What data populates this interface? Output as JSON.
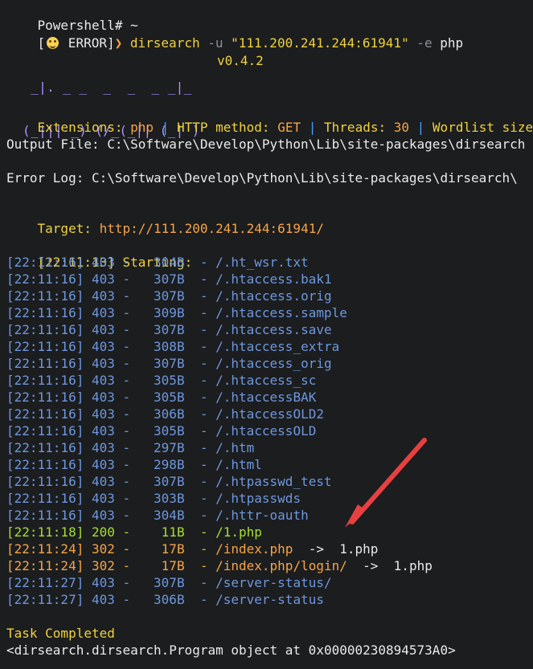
{
  "app": {
    "title": "Powershell# ~"
  },
  "prompt": {
    "prefix": "[",
    "emoji_icon": "grinning-face-icon",
    "status": " ERROR",
    "suffix": "]",
    "chevron": "❯",
    "command": "dirsearch",
    "args": [
      {
        "text": "-u",
        "kind": "flag"
      },
      {
        "text": "\"111.200.241.244:61941\"",
        "kind": "string"
      },
      {
        "text": "-e",
        "kind": "flag"
      },
      {
        "text": "php",
        "kind": "value"
      }
    ]
  },
  "logo": {
    "lines": [
      "  _|. _ _  _  _  _ _|_",
      " (_||| _) (/_(_|| (_| )"
    ],
    "version": "v0.4.2"
  },
  "summary": {
    "extensions_label": "Extensions:",
    "extensions_value": "php",
    "sep1": "|",
    "method_label": "HTTP method:",
    "method_value": "GET",
    "sep2": "|",
    "threads_label": "Threads:",
    "threads_value": "30",
    "sep3": "|",
    "wordlist_label": "Wordlist size:"
  },
  "output_file": "Output File: C:\\Software\\Develop\\Python\\Lib\\site-packages\\dirsearch",
  "error_log": "Error Log: C:\\Software\\Develop\\Python\\Lib\\site-packages\\dirsearch\\",
  "target": {
    "label": "Target:",
    "url": "http://111.200.241.244:61941/"
  },
  "starting": {
    "time": "[22:11:13]",
    "text": "Starting:"
  },
  "results": [
    {
      "time": "[22:11:16]",
      "code": "403",
      "size": "304B",
      "path": "/.ht_wsr.txt"
    },
    {
      "time": "[22:11:16]",
      "code": "403",
      "size": "307B",
      "path": "/.htaccess.bak1"
    },
    {
      "time": "[22:11:16]",
      "code": "403",
      "size": "307B",
      "path": "/.htaccess.orig"
    },
    {
      "time": "[22:11:16]",
      "code": "403",
      "size": "309B",
      "path": "/.htaccess.sample"
    },
    {
      "time": "[22:11:16]",
      "code": "403",
      "size": "307B",
      "path": "/.htaccess.save"
    },
    {
      "time": "[22:11:16]",
      "code": "403",
      "size": "308B",
      "path": "/.htaccess_extra"
    },
    {
      "time": "[22:11:16]",
      "code": "403",
      "size": "307B",
      "path": "/.htaccess_orig"
    },
    {
      "time": "[22:11:16]",
      "code": "403",
      "size": "305B",
      "path": "/.htaccess_sc"
    },
    {
      "time": "[22:11:16]",
      "code": "403",
      "size": "305B",
      "path": "/.htaccessBAK"
    },
    {
      "time": "[22:11:16]",
      "code": "403",
      "size": "306B",
      "path": "/.htaccessOLD2"
    },
    {
      "time": "[22:11:16]",
      "code": "403",
      "size": "305B",
      "path": "/.htaccessOLD"
    },
    {
      "time": "[22:11:16]",
      "code": "403",
      "size": "297B",
      "path": "/.htm"
    },
    {
      "time": "[22:11:16]",
      "code": "403",
      "size": "298B",
      "path": "/.html"
    },
    {
      "time": "[22:11:16]",
      "code": "403",
      "size": "307B",
      "path": "/.htpasswd_test"
    },
    {
      "time": "[22:11:16]",
      "code": "403",
      "size": "303B",
      "path": "/.htpasswds"
    },
    {
      "time": "[22:11:16]",
      "code": "403",
      "size": "304B",
      "path": "/.httr-oauth"
    },
    {
      "time": "[22:11:18]",
      "code": "200",
      "size": "11B",
      "path": "/1.php"
    },
    {
      "time": "[22:11:24]",
      "code": "302",
      "size": "17B",
      "path": "/index.php",
      "redirect": "1.php"
    },
    {
      "time": "[22:11:24]",
      "code": "302",
      "size": "17B",
      "path": "/index.php/login/",
      "redirect": "1.php"
    },
    {
      "time": "[22:11:27]",
      "code": "403",
      "size": "307B",
      "path": "/server-status/"
    },
    {
      "time": "[22:11:27]",
      "code": "403",
      "size": "306B",
      "path": "/server-status"
    }
  ],
  "task_completed": "Task Completed",
  "object_repr": "<dirsearch.dirsearch.Program object at 0x00000230894573A0>",
  "colors": {
    "background": "#1b1d1f",
    "text": "#eaeaea",
    "yellow": "#f0d23d",
    "orange": "#f7a446",
    "blue": "#6f97de",
    "green": "#a8dd34",
    "purple": "#b190ff",
    "arrow": "#e84040"
  }
}
